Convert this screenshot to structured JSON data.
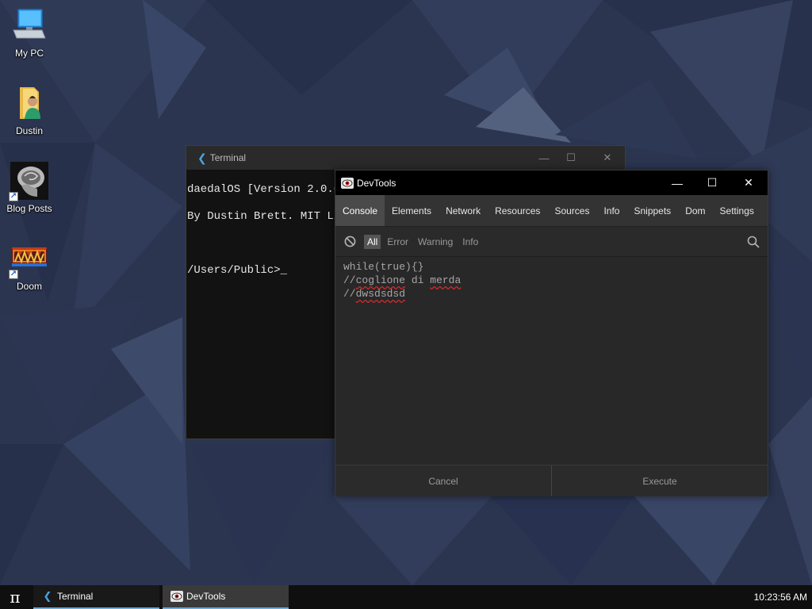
{
  "desktop": {
    "icons": [
      {
        "label": "My PC",
        "icon": "computer-icon"
      },
      {
        "label": "Dustin",
        "icon": "user-folder-icon"
      },
      {
        "label": "Blog Posts",
        "icon": "brain-mri-icon"
      },
      {
        "label": "Doom",
        "icon": "doom-logo-icon"
      }
    ]
  },
  "terminal": {
    "title": "Terminal",
    "lines": [
      "daedalOS [Version 2.0.0-",
      "By Dustin Brett. MIT Lic",
      "",
      "/Users/Public>_"
    ]
  },
  "devtools": {
    "title": "DevTools",
    "tabs": [
      "Console",
      "Elements",
      "Network",
      "Resources",
      "Sources",
      "Info",
      "Snippets",
      "Dom",
      "Settings"
    ],
    "active_tab": "Console",
    "filters": [
      "All",
      "Error",
      "Warning",
      "Info"
    ],
    "active_filter": "All",
    "code_lines": [
      "while(true){}",
      "//coglione di merda",
      "//dwsdsdsd"
    ],
    "cancel_label": "Cancel",
    "execute_label": "Execute"
  },
  "taskbar": {
    "start_symbol": "π",
    "entries": [
      {
        "label": "Terminal",
        "icon": "terminal-icon"
      },
      {
        "label": "DevTools",
        "icon": "devtools-eye-icon"
      }
    ],
    "clock": "10:23:56 AM"
  },
  "colors": {
    "wallpaper": "#2b3550",
    "taskbar_accent": "#6aa8d8",
    "error_squiggle": "#d02b2b"
  }
}
